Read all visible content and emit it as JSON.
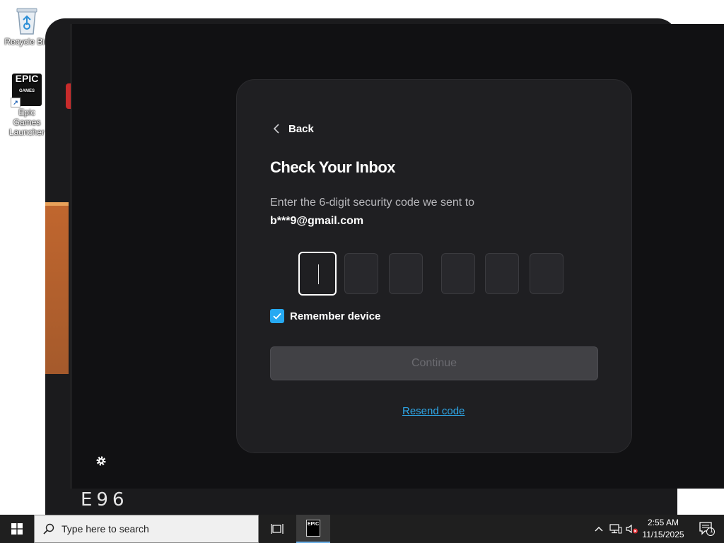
{
  "desktop": {
    "icons": [
      {
        "label": "Recycle Bin"
      },
      {
        "label": "Epic Games Launcher",
        "logo_top": "EPIC",
        "logo_bottom": "GAMES"
      }
    ]
  },
  "background_window": {
    "text_fragment": "E96"
  },
  "dialog": {
    "back_label": "Back",
    "title": "Check Your Inbox",
    "instruction": "Enter the 6-digit security code we sent to",
    "email": "b***9@gmail.com",
    "code_digits": [
      "",
      "",
      "",
      "",
      "",
      ""
    ],
    "remember_label": "Remember device",
    "remember_checked": true,
    "continue_label": "Continue",
    "continue_enabled": false,
    "resend_label": "Resend code"
  },
  "taskbar": {
    "search_placeholder": "Type here to search",
    "pinned_app": "EPIC",
    "time": "2:55 AM",
    "date": "11/15/2025",
    "notification_count": "1"
  },
  "colors": {
    "accent": "#26a9f2",
    "link": "#2ea7e8",
    "card_bg": "#1f1f22"
  }
}
